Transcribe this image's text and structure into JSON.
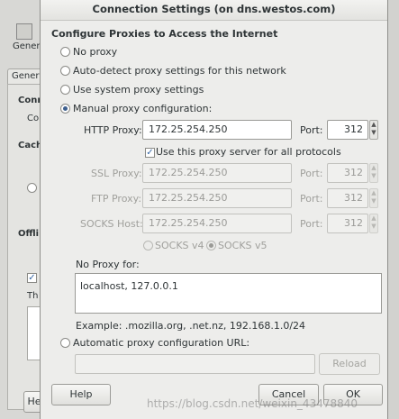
{
  "background": {
    "toolbar_label": "Gener",
    "tab_label": "Gener",
    "section_conn": "Conn",
    "conn_label": "Co",
    "section_cache": "Cach",
    "section_offline": "Offli",
    "text_th": "Th",
    "help_button": "He"
  },
  "dialog": {
    "title": "Connection Settings (on dns.westos.com)",
    "heading": "Configure Proxies to Access the Internet",
    "options": {
      "no_proxy": "No proxy",
      "auto_detect": "Auto-detect proxy settings for this network",
      "system": "Use system proxy settings",
      "manual": "Manual proxy configuration:",
      "auto_url": "Automatic proxy configuration URL:"
    },
    "selected_option": "manual",
    "http": {
      "label": "HTTP Proxy:",
      "value": "172.25.254.250",
      "port_label": "Port:",
      "port": "312"
    },
    "share_checkbox": {
      "label": "Use this proxy server for all protocols",
      "checked": true
    },
    "ssl": {
      "label": "SSL Proxy:",
      "value": "172.25.254.250",
      "port_label": "Port:",
      "port": "312"
    },
    "ftp": {
      "label": "FTP Proxy:",
      "value": "172.25.254.250",
      "port_label": "Port:",
      "port": "312"
    },
    "socks": {
      "label": "SOCKS Host:",
      "value": "172.25.254.250",
      "port_label": "Port:",
      "port": "312"
    },
    "socks_v4": "SOCKS v4",
    "socks_v5": "SOCKS v5",
    "no_proxy_label": "No Proxy for:",
    "no_proxy_value": "localhost, 127.0.0.1",
    "example": "Example: .mozilla.org, .net.nz, 192.168.1.0/24",
    "auto_url_value": "",
    "reload_button": "Reload",
    "help_button": "Help",
    "cancel_button": "Cancel",
    "ok_button": "OK"
  },
  "watermark": "https://blog.csdn.net/weixin_43478840"
}
